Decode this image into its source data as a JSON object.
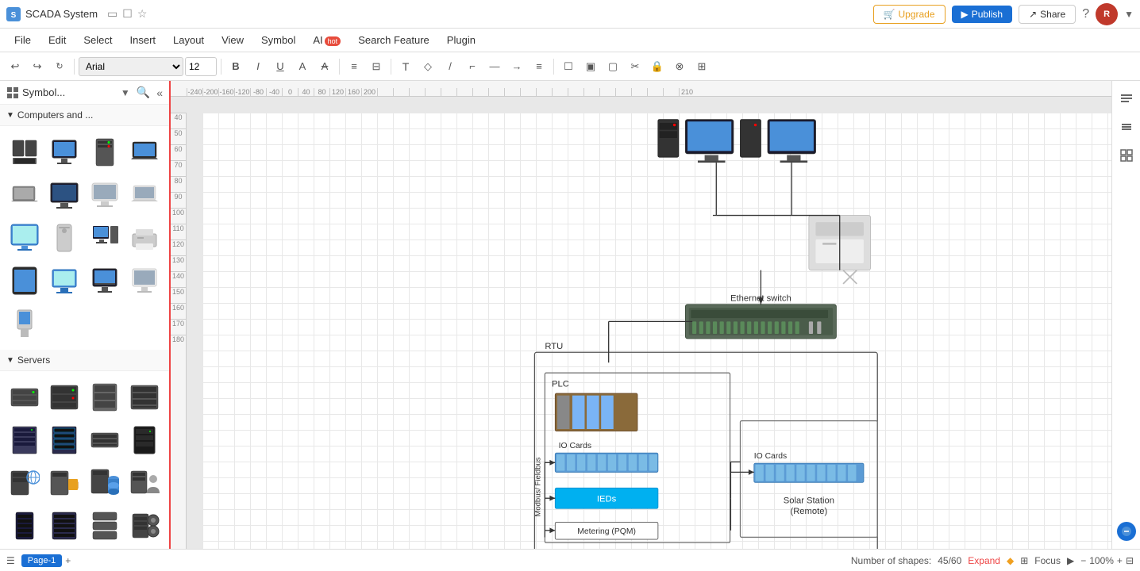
{
  "app": {
    "title": "SCADA System",
    "icon": "S"
  },
  "topbar": {
    "upgrade_label": "Upgrade",
    "publish_label": "Publish",
    "share_label": "Share",
    "avatar_label": "R",
    "help_label": "?"
  },
  "menubar": {
    "items": [
      {
        "label": "File"
      },
      {
        "label": "Edit"
      },
      {
        "label": "Select"
      },
      {
        "label": "Insert"
      },
      {
        "label": "Layout"
      },
      {
        "label": "View"
      },
      {
        "label": "Symbol"
      },
      {
        "label": "AI",
        "badge": "hot"
      },
      {
        "label": "Search Feature"
      },
      {
        "label": "Plugin"
      }
    ]
  },
  "toolbar": {
    "font": "Arial",
    "font_size": "12",
    "undo_label": "↩",
    "redo_label": "↪"
  },
  "sidebar": {
    "title": "Symbol...",
    "sections": [
      {
        "name": "Computers and ...",
        "expanded": true,
        "items": [
          "desktop-tower",
          "desktop-monitor",
          "server-tower",
          "laptop",
          "notebook",
          "monitor-blue",
          "mac-monitor",
          "laptop-silver",
          "imac",
          "mac-tower",
          "desktop-setup",
          "printer",
          "tablet",
          "monitor-flat",
          "monitor-stand",
          "monitor-white",
          "kiosk"
        ]
      },
      {
        "name": "Servers",
        "expanded": true,
        "items": [
          "server-1u",
          "server-2u",
          "server-3u",
          "server-4u",
          "rack-server",
          "rack-server-2",
          "server-flat",
          "server-dark",
          "server-globe",
          "server-folder",
          "server-db",
          "server-user",
          "server-tall",
          "server-rack",
          "server-stack",
          "server-drive"
        ]
      }
    ]
  },
  "canvas": {
    "zoom": "100%",
    "shapes_count": "45/60",
    "shapes_label": "Number of shapes:",
    "expand_label": "Expand"
  },
  "statusbar": {
    "page_label": "Page-1",
    "add_page_label": "+",
    "active_tab": "Page-1",
    "focus_label": "Focus",
    "zoom_label": "100%"
  },
  "diagram": {
    "title": "SCADA System",
    "ethernet_switch": "Ethernet switch",
    "rtu_label": "RTU",
    "plc_label": "PLC",
    "io_cards_label": "IO Cards",
    "io_cards_remote_label": "IO Cards",
    "solar_station_label": "Solar Station\n(Remote)",
    "ieds_label": "IEDs",
    "metering_label": "Metering (PQM)",
    "modbus_label": "Modbus/ Fieldbus"
  },
  "colors": {
    "accent": "#e44444",
    "blue_btn": "#1a6fd4",
    "upgrade_border": "#e8a020",
    "sidebar_border": "#e44444",
    "io_cards_color": "#5b9bd5",
    "ieds_color": "#00b0f0",
    "plc_color": "#70ad47"
  },
  "ruler": {
    "h_marks": [
      "-240",
      "-200",
      "-160",
      "-120",
      "-80",
      "-40",
      "0",
      "40",
      "80",
      "120",
      "160",
      "200"
    ],
    "v_marks": [
      "40",
      "50",
      "60",
      "70",
      "80",
      "90",
      "100",
      "110",
      "120",
      "130",
      "140",
      "150",
      "160",
      "170",
      "180"
    ]
  }
}
